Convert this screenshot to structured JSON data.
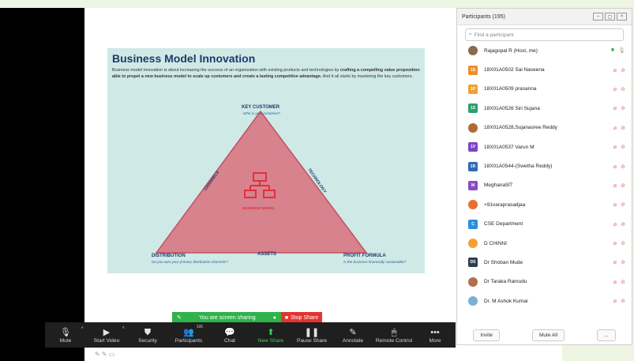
{
  "slide": {
    "title": "Business Model Innovation",
    "desc_plain": "Business model innovation is about increasing the success of an organization with existing products and technologies by ",
    "desc_bold": "crafting a compelling value proposition able to propel a new business model to scale up customers and create a lasting competitive advantage.",
    "desc_end": " And it all starts by mastering the key customers.",
    "key_customer": "KEY CUSTOMER",
    "key_customer_sub": "Who is your customer?",
    "channels": "CHANNELS",
    "technology": "TECHNOLOGY",
    "center": "BUSINESS MODEL",
    "distribution": "DISTRIBUTION",
    "distribution_sub": "Do you own your primary distribution channels?",
    "assets": "ASSETS",
    "profit": "PROFIT FORMULA",
    "profit_sub": "Is the business financially sustainable?"
  },
  "share_bar": {
    "status": "You are screen sharing",
    "stop": "Stop Share"
  },
  "toolbar": {
    "mute": "Mute",
    "start_video": "Start Video",
    "security": "Security",
    "participants": "Participants",
    "participants_count": "195",
    "chat": "Chat",
    "new_share": "New Share",
    "pause_share": "Pause Share",
    "annotate": "Annotate",
    "remote_control": "Remote Control",
    "more": "More"
  },
  "panel": {
    "title": "Participants (195)",
    "search_placeholder": "Find a participant",
    "invite": "Invite",
    "mute_all": "Mute All",
    "more": "...",
    "participants": [
      {
        "initials": "",
        "name": "Rajagopal R (Host, me)",
        "color": "#8a6a4a",
        "host": true
      },
      {
        "initials": "1S",
        "name": "18X01A0502 Sai Naveena",
        "color": "#f08c2a"
      },
      {
        "initials": "1P",
        "name": "18X01A0509  prasanna",
        "color": "#f0a030"
      },
      {
        "initials": "1S",
        "name": "18X01A0526  Siri Sujana",
        "color": "#2aa06a"
      },
      {
        "initials": "",
        "name": "18X01A0528,Sujanasree Reddy",
        "color": "#b06a30"
      },
      {
        "initials": "1V",
        "name": "18X01A0537 Varun M",
        "color": "#7a45c4"
      },
      {
        "initials": "1R",
        "name": "18X01A0544-(Swetha Reddy)",
        "color": "#2f6bb5"
      },
      {
        "initials": "M",
        "name": "Meghana5f7",
        "color": "#8c4ac4"
      },
      {
        "initials": "",
        "name": "+91varaprasadjaa",
        "color": "#e8702a"
      },
      {
        "initials": "C",
        "name": "CSE Department",
        "color": "#2a8fe0"
      },
      {
        "initials": "",
        "name": "D CHINNI",
        "color": "#f5a030"
      },
      {
        "initials": "DS",
        "name": "Dr Shoban Mude",
        "color": "#2c3e50"
      },
      {
        "initials": "",
        "name": "Dr Taraka Ramudu",
        "color": "#b07050"
      },
      {
        "initials": "",
        "name": "Dr. M Ashok Kumar",
        "color": "#7ab0d8"
      }
    ]
  }
}
